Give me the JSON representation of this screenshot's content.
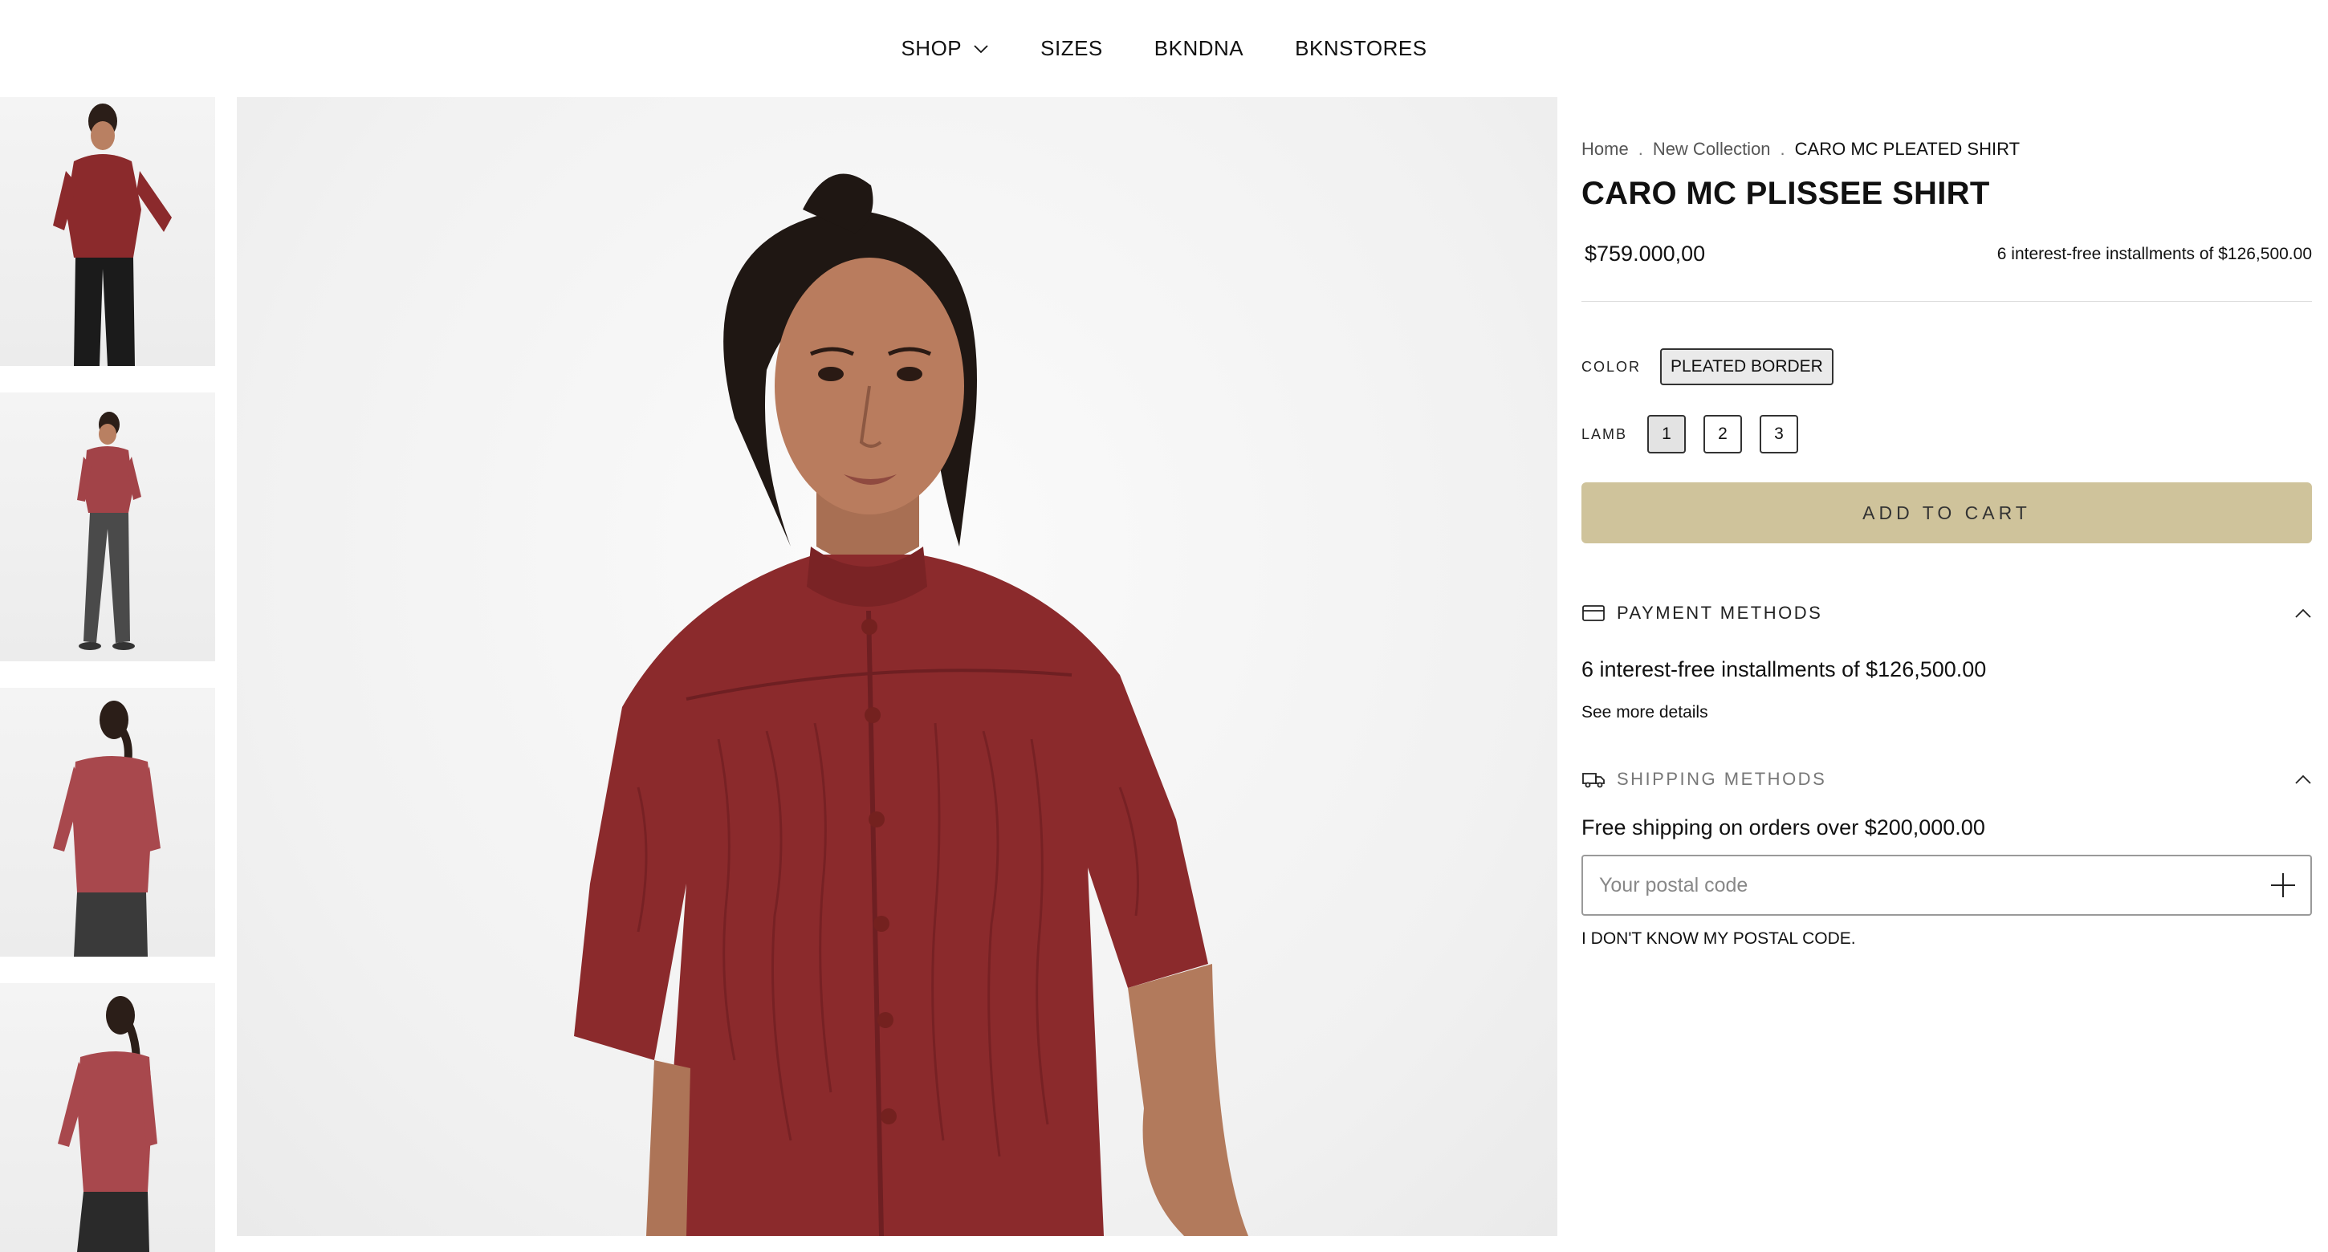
{
  "nav": {
    "shop": "SHOP",
    "sizes": "SIZES",
    "bkndna": "BKNDNA",
    "bknstores": "BKNSTORES"
  },
  "breadcrumb": {
    "home": "Home",
    "collection": "New Collection",
    "current": "CARO MC PLEATED SHIRT",
    "separator": "."
  },
  "product": {
    "title": "CARO MC PLISSEE SHIRT",
    "price": "$759.000,00",
    "installments_note": "6 interest-free installments of $126,500.00",
    "color_label": "COLOR",
    "color_value": "PLEATED BORDER",
    "size_label": "LAMB",
    "sizes": [
      "1",
      "2",
      "3"
    ],
    "selected_size": "1",
    "add_to_cart": "ADD TO CART"
  },
  "payment": {
    "title": "PAYMENT METHODS",
    "text": "6 interest-free installments of $126,500.00",
    "link": "See more details"
  },
  "shipping": {
    "title": "SHIPPING METHODS",
    "text": "Free shipping on orders over $200,000.00",
    "postal_placeholder": "Your postal code",
    "postal_value": "",
    "no_postal_link": "I DON'T KNOW MY POSTAL CODE."
  },
  "colors": {
    "accent_button": "#cfc39b",
    "garment": "#8b2a2c"
  },
  "icons": {
    "shop_dropdown": "chevron-down-icon",
    "payment": "credit-card-icon",
    "shipping": "truck-icon",
    "accordion": "chevron-up-icon",
    "postal_add": "plus-icon"
  }
}
